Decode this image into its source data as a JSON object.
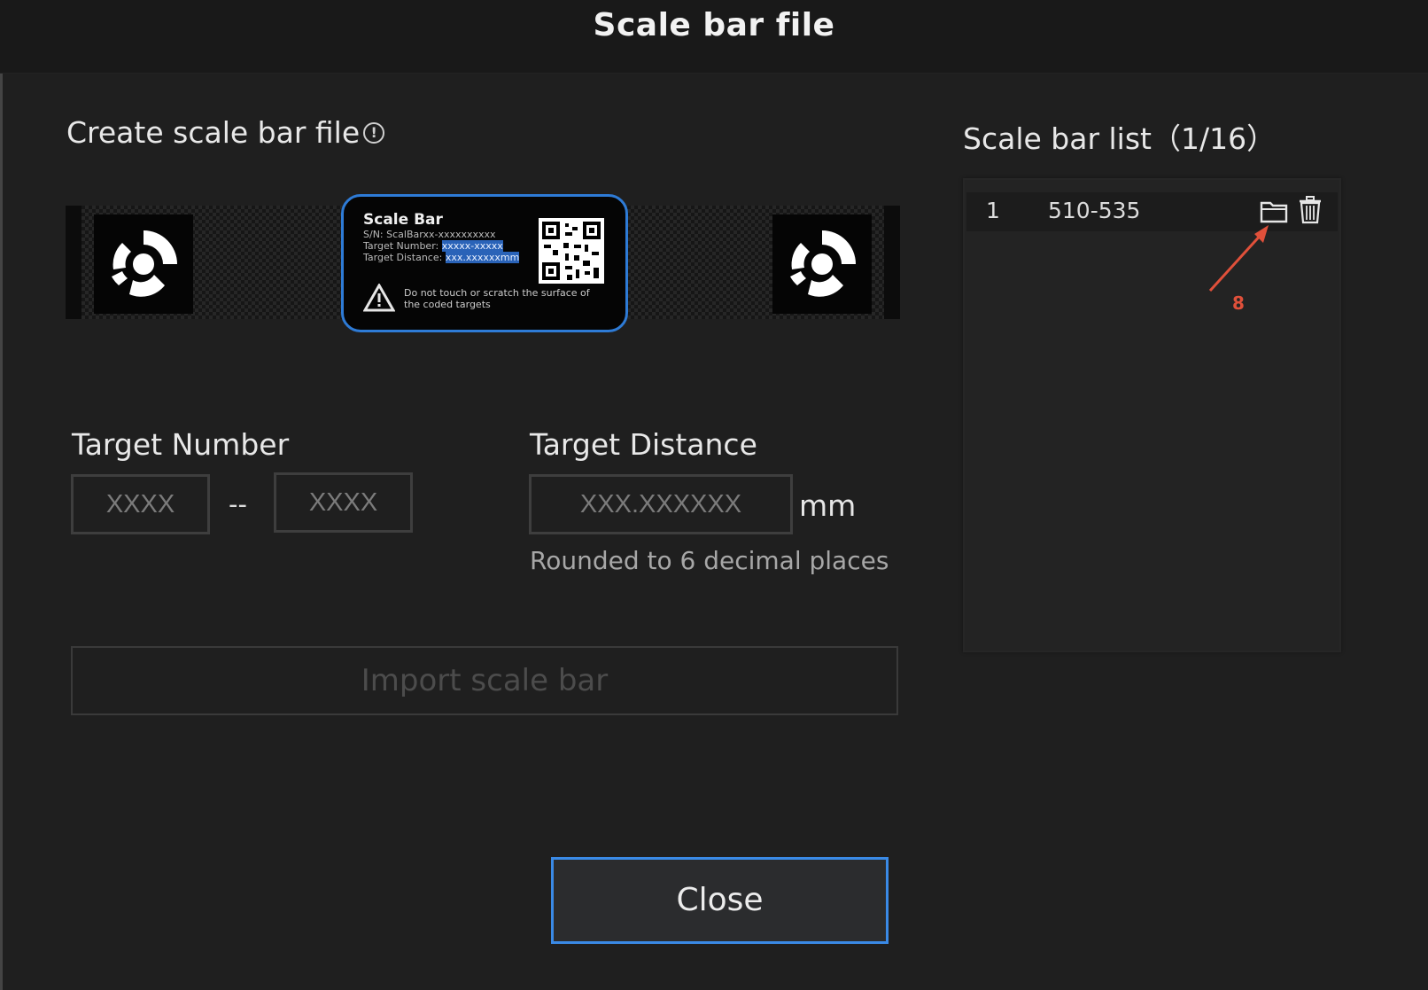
{
  "dialog": {
    "title": "Scale bar file"
  },
  "create_section": {
    "title": "Create scale bar file",
    "info_icon": "info-icon"
  },
  "illustration": {
    "card_title": "Scale Bar",
    "sn_line": "S/N: ScalBarxx-xxxxxxxxxx",
    "target_number_label": "Target Number: ",
    "target_number_value": "xxxxx-xxxxx",
    "target_distance_label": "Target Distance: ",
    "target_distance_value": "xxx.xxxxxxmm",
    "warning": "Do not touch or scratch the surface of the coded targets"
  },
  "target_number": {
    "label": "Target Number",
    "from_placeholder": "XXXX",
    "separator": "--",
    "to_placeholder": "XXXX"
  },
  "target_distance": {
    "label": "Target Distance",
    "placeholder": "XXX.XXXXXX",
    "unit": "mm",
    "hint": "Rounded to 6 decimal places"
  },
  "import_button": {
    "label": "Import scale bar"
  },
  "scale_bar_list": {
    "title": "Scale bar list（1/16）",
    "items": [
      {
        "index": "1",
        "name": "510-535"
      }
    ]
  },
  "annotation": {
    "label": "8",
    "color": "#e0503a"
  },
  "close_button": {
    "label": "Close"
  },
  "colors": {
    "accent": "#3a8ae6",
    "background": "#1f1f1f"
  }
}
